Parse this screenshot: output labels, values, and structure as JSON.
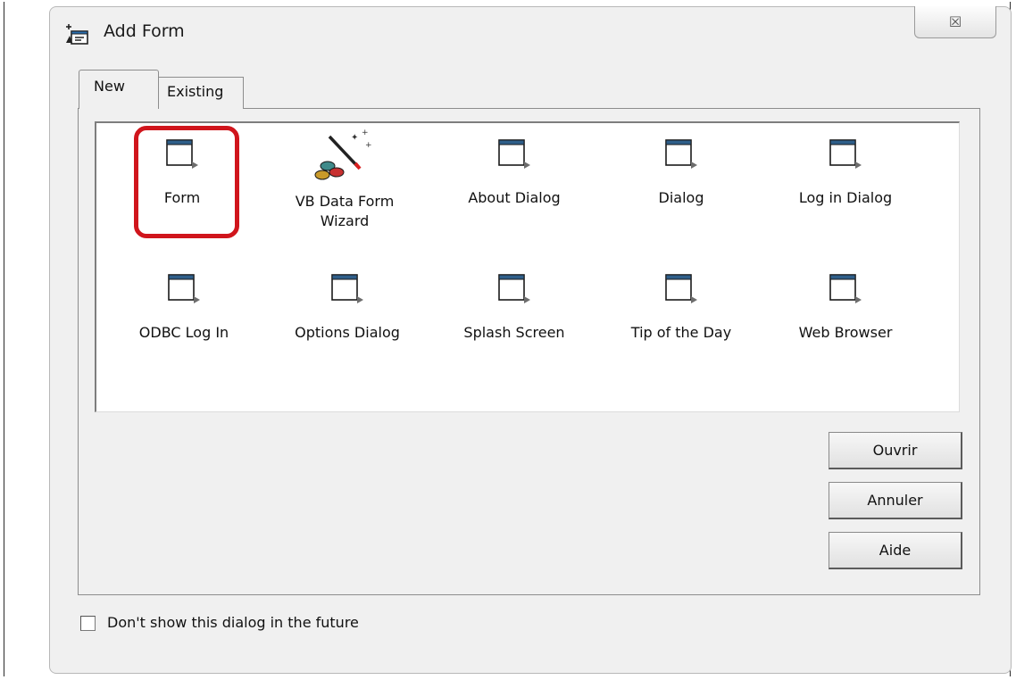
{
  "window": {
    "title": "Add Form",
    "close_glyph": "☒"
  },
  "tabs": [
    {
      "label": "New",
      "selected": true
    },
    {
      "label": "Existing",
      "selected": false
    }
  ],
  "templates": [
    {
      "label": "Form",
      "icon": "form-icon",
      "highlighted": true
    },
    {
      "label": "VB Data Form Wizard",
      "icon": "magic-wand-icon"
    },
    {
      "label": "About Dialog",
      "icon": "form-icon"
    },
    {
      "label": "Dialog",
      "icon": "form-icon"
    },
    {
      "label": "Log in Dialog",
      "icon": "form-icon"
    },
    {
      "label": "ODBC Log In",
      "icon": "form-icon"
    },
    {
      "label": "Options Dialog",
      "icon": "form-icon"
    },
    {
      "label": "Splash Screen",
      "icon": "form-icon"
    },
    {
      "label": "Tip of the Day",
      "icon": "form-icon"
    },
    {
      "label": "Web Browser",
      "icon": "form-icon"
    }
  ],
  "buttons": {
    "open": "Ouvrir",
    "cancel": "Annuler",
    "help": "Aide"
  },
  "checkbox": {
    "label": "Don't show this dialog in the future",
    "checked": false
  },
  "colors": {
    "highlight": "#d0151c",
    "dialog_bg": "#f0f0f0",
    "list_bg": "#ffffff"
  }
}
